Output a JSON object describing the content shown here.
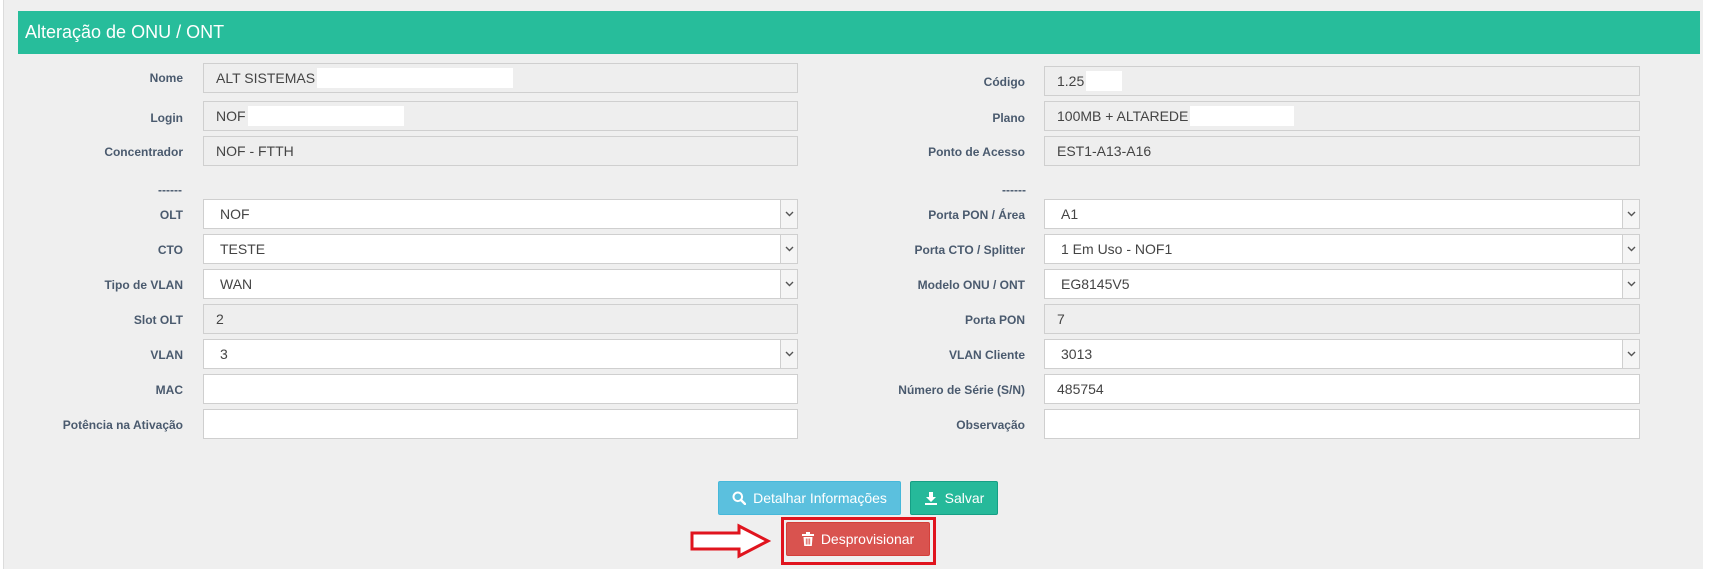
{
  "header": {
    "title": "Alteração de ONU / ONT"
  },
  "left": {
    "nome": {
      "label": "Nome",
      "value": "ALT SISTEMAS"
    },
    "login": {
      "label": "Login",
      "value": "NOF"
    },
    "concentrador": {
      "label": "Concentrador",
      "value": "NOF - FTTH"
    },
    "divider": "------",
    "olt": {
      "label": "OLT",
      "value": "NOF"
    },
    "cto": {
      "label": "CTO",
      "value": "TESTE"
    },
    "tipo_vlan": {
      "label": "Tipo de VLAN",
      "value": "WAN"
    },
    "slot_olt": {
      "label": "Slot OLT",
      "value": "2"
    },
    "vlan": {
      "label": "VLAN",
      "value": "3"
    },
    "mac": {
      "label": "MAC",
      "value": ""
    },
    "potencia": {
      "label": "Potência na Ativação",
      "value": ""
    }
  },
  "right": {
    "codigo": {
      "label": "Código",
      "value": "1.25"
    },
    "plano": {
      "label": "Plano",
      "value": "100MB + ALTAREDE"
    },
    "ponto_acesso": {
      "label": "Ponto de Acesso",
      "value": "EST1-A13-A16"
    },
    "divider": "------",
    "porta_pon_area": {
      "label": "Porta PON / Área",
      "value": "A1"
    },
    "porta_cto": {
      "label": "Porta CTO / Splitter",
      "value": "1 Em Uso - NOF1"
    },
    "modelo_onu": {
      "label": "Modelo ONU / ONT",
      "value": "EG8145V5"
    },
    "porta_pon": {
      "label": "Porta PON",
      "value": "7"
    },
    "vlan_cliente": {
      "label": "VLAN Cliente",
      "value": "3013"
    },
    "numero_serie": {
      "label": "Número de Série (S/N)",
      "value": "485754"
    },
    "observacao": {
      "label": "Observação",
      "value": ""
    }
  },
  "actions": {
    "detalhar": "Detalhar Informações",
    "salvar": "Salvar",
    "desprovisionar": "Desprovisionar"
  },
  "colors": {
    "header": "#27bd9b",
    "info": "#5bc0de",
    "success": "#26b99a",
    "danger": "#d9534f",
    "highlight": "#e0141e"
  }
}
